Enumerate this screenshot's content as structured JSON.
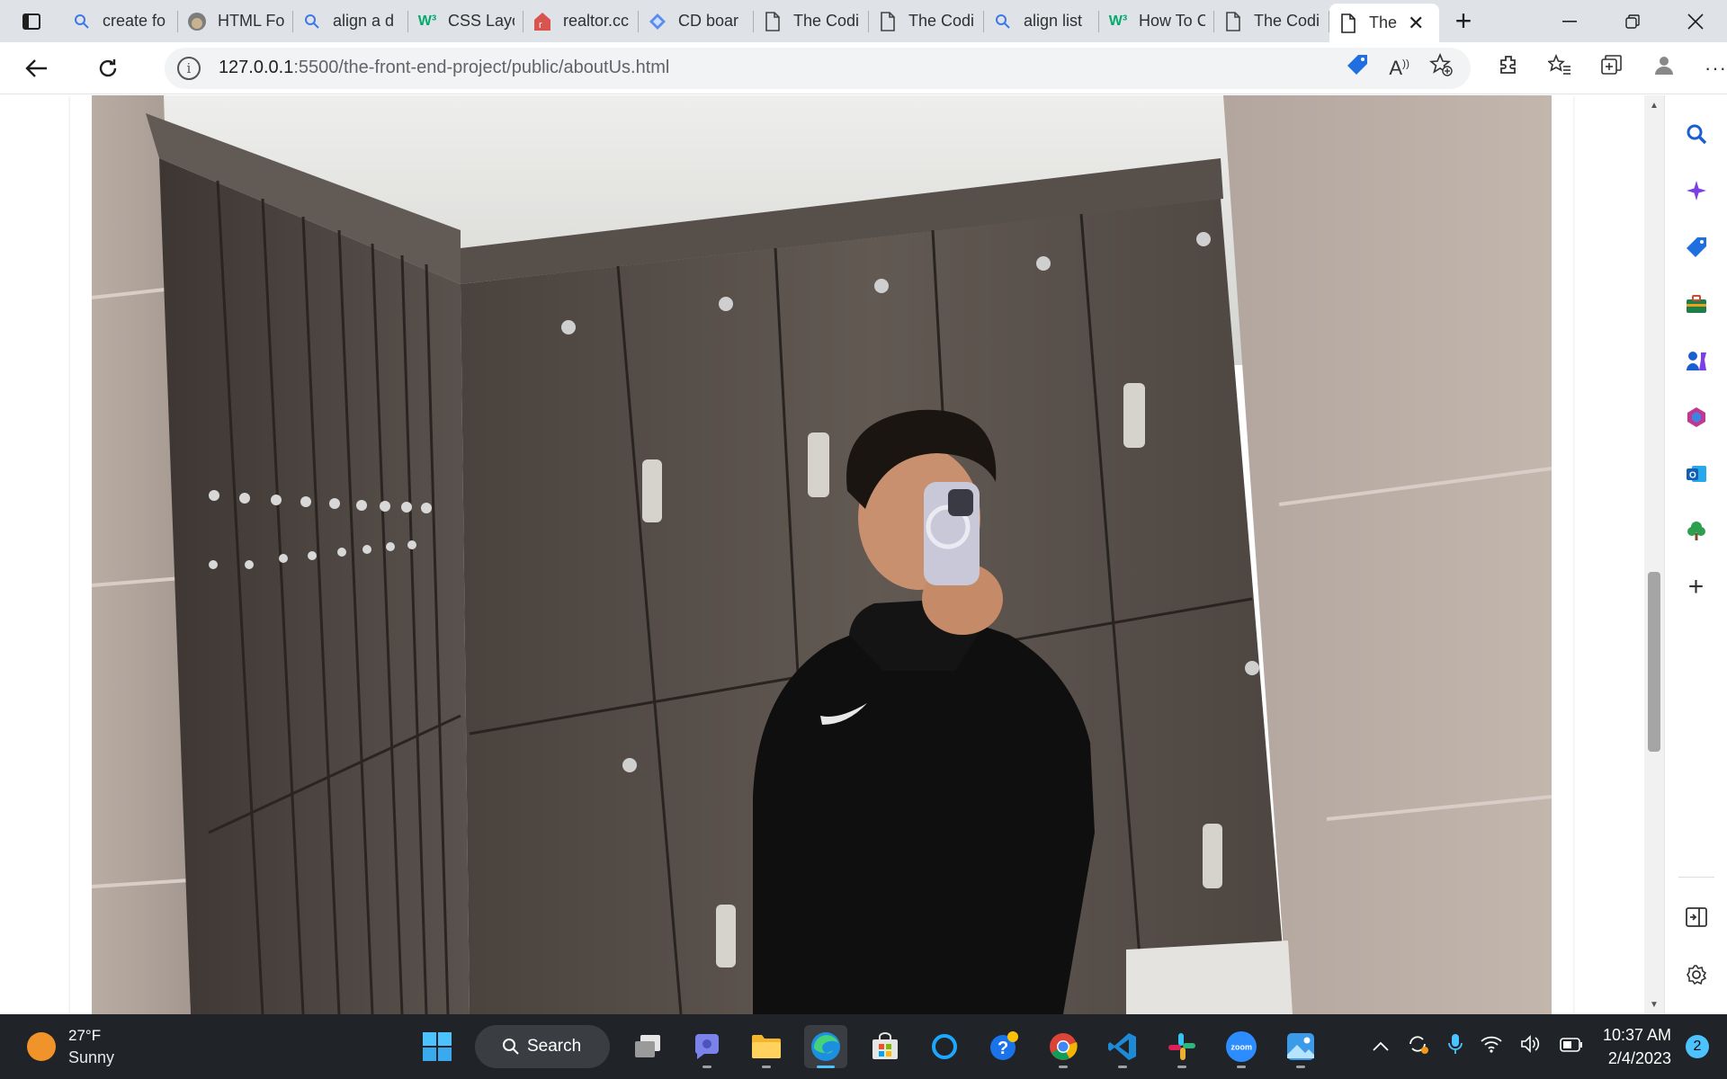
{
  "browser": {
    "tabs": [
      {
        "label": "create fo",
        "icon": "search-icon"
      },
      {
        "label": "HTML Fo",
        "icon": "site-avatar-icon"
      },
      {
        "label": "align a d",
        "icon": "search-icon"
      },
      {
        "label": "CSS Layo",
        "icon": "w3schools-icon"
      },
      {
        "label": "realtor.cc",
        "icon": "realtor-icon"
      },
      {
        "label": "CD boar",
        "icon": "diamond-icon"
      },
      {
        "label": "The Codi",
        "icon": "page-icon"
      },
      {
        "label": "The Codi",
        "icon": "page-icon"
      },
      {
        "label": "align list",
        "icon": "search-icon"
      },
      {
        "label": "How To C",
        "icon": "w3schools-icon"
      },
      {
        "label": "The Codi",
        "icon": "page-icon"
      },
      {
        "label": "The",
        "icon": "page-icon",
        "active": true
      }
    ],
    "url_host": "127.0.0.1",
    "url_path": ":5500/the-front-end-project/public/aboutUs.html"
  },
  "page": {
    "image_alt": "Mirror selfie in a locker room"
  },
  "taskbar": {
    "weather_temp": "27°F",
    "weather_desc": "Sunny",
    "search_label": "Search",
    "time": "10:37 AM",
    "date": "2/4/2023",
    "notification_count": "2"
  },
  "colors": {
    "accent": "#4cc2ff",
    "tabstrip": "#dfe3e8",
    "taskbar": "#202428"
  }
}
